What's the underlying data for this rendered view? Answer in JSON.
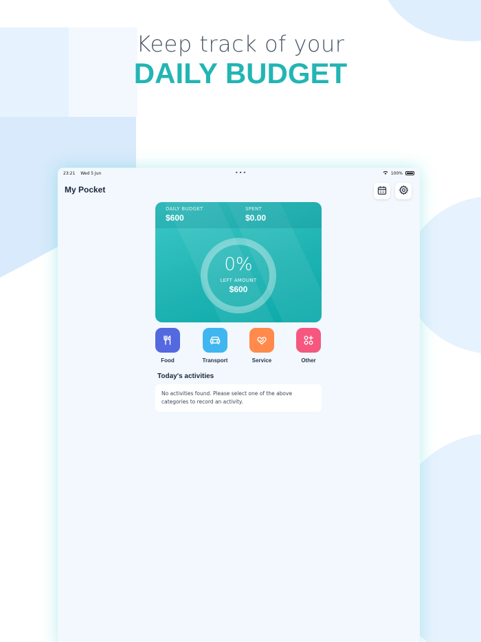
{
  "headline": {
    "line1": "Keep track of your",
    "line2": "DAILY BUDGET"
  },
  "statusbar": {
    "time": "23:21",
    "date": "Wed 5 Jun",
    "battery": "100%"
  },
  "app": {
    "title": "My Pocket"
  },
  "budget_card": {
    "daily_budget_label": "DAILY BUDGET",
    "daily_budget_value": "$600",
    "spent_label": "SPENT",
    "spent_value": "$0.00",
    "percent": "0%",
    "left_amount_label": "LEFT AMOUNT",
    "left_amount_value": "$600",
    "progress_fraction": 0
  },
  "categories": [
    {
      "label": "Food",
      "icon": "fork-knife-icon",
      "color": "#5468e0"
    },
    {
      "label": "Transport",
      "icon": "car-icon",
      "color": "#3fb6ef"
    },
    {
      "label": "Service",
      "icon": "hand-heart-icon",
      "color": "#ff8a4c"
    },
    {
      "label": "Other",
      "icon": "grid-plus-icon",
      "color": "#f5577f"
    }
  ],
  "activities": {
    "title": "Today's activities",
    "empty_message": "No activities found. Please select one of the above categories to record an activity."
  },
  "colors": {
    "accent": "#22b5b4",
    "card": "#20b4b3"
  }
}
